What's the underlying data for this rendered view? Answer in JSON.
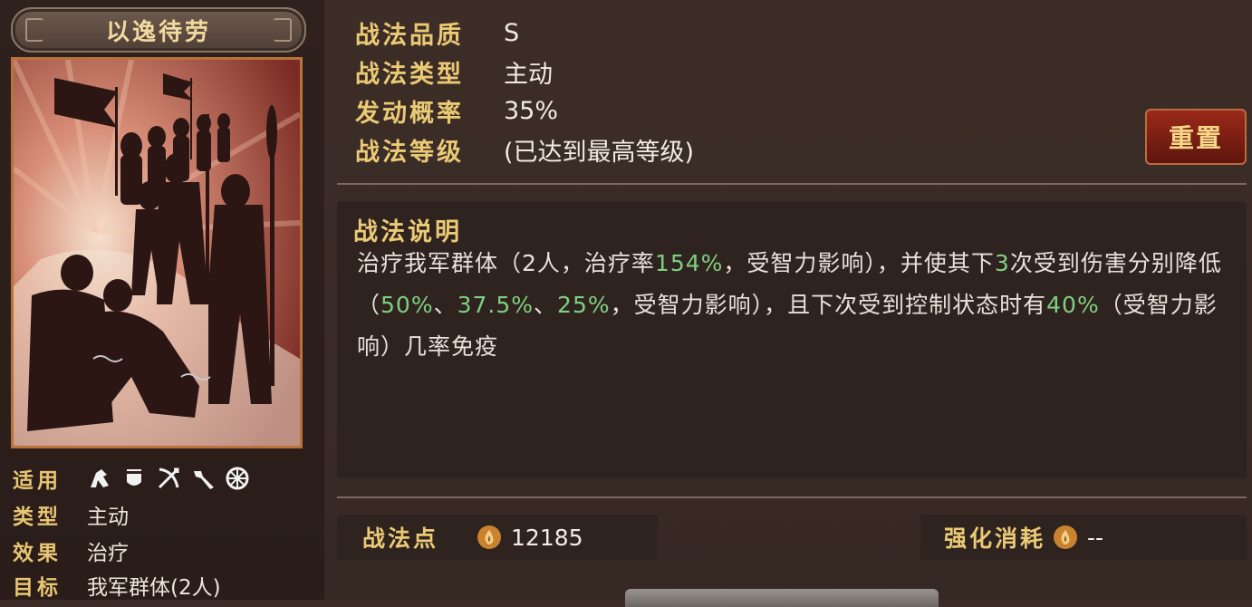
{
  "skill": {
    "name": "以逸待劳"
  },
  "left_info": {
    "applicable_label": "适用",
    "unit_icons": [
      "cavalry-icon",
      "shield-icon",
      "bow-icon",
      "spear-icon",
      "siege-icon"
    ],
    "type_label": "类型",
    "type_value": "主动",
    "effect_label": "效果",
    "effect_value": "治疗",
    "target_label": "目标",
    "target_value": "我军群体(2人)"
  },
  "stats": {
    "quality_label": "战法品质",
    "quality_value": "S",
    "type_label": "战法类型",
    "type_value": "主动",
    "rate_label": "发动概率",
    "rate_value": "35%",
    "level_label": "战法等级",
    "level_value": "(已达到最高等级)"
  },
  "reset_button": "重置",
  "description": {
    "title": "战法说明",
    "segments": [
      {
        "text": "治疗我军群体（2人，治疗率",
        "highlight": false
      },
      {
        "text": "154%",
        "highlight": true
      },
      {
        "text": "，受智力影响），并使其下",
        "highlight": false
      },
      {
        "text": "3",
        "highlight": true
      },
      {
        "text": "次受到伤害分别降低（",
        "highlight": false
      },
      {
        "text": "50%",
        "highlight": true
      },
      {
        "text": "、",
        "highlight": false
      },
      {
        "text": "37.5%",
        "highlight": true
      },
      {
        "text": "、",
        "highlight": false
      },
      {
        "text": "25%",
        "highlight": true
      },
      {
        "text": "，受智力影响），且下次受到控制状态时有",
        "highlight": false
      },
      {
        "text": "40%",
        "highlight": true
      },
      {
        "text": "（受智力影响）几率免疫",
        "highlight": false
      }
    ]
  },
  "points": {
    "label": "战法点",
    "value": "12185",
    "icon": "coin-icon"
  },
  "cost": {
    "label": "强化消耗",
    "value": "--",
    "icon": "coin-icon"
  },
  "colors": {
    "accent_gold": "#ebca75",
    "highlight_green": "#7fd07f",
    "button_red": "#7a1f12"
  }
}
